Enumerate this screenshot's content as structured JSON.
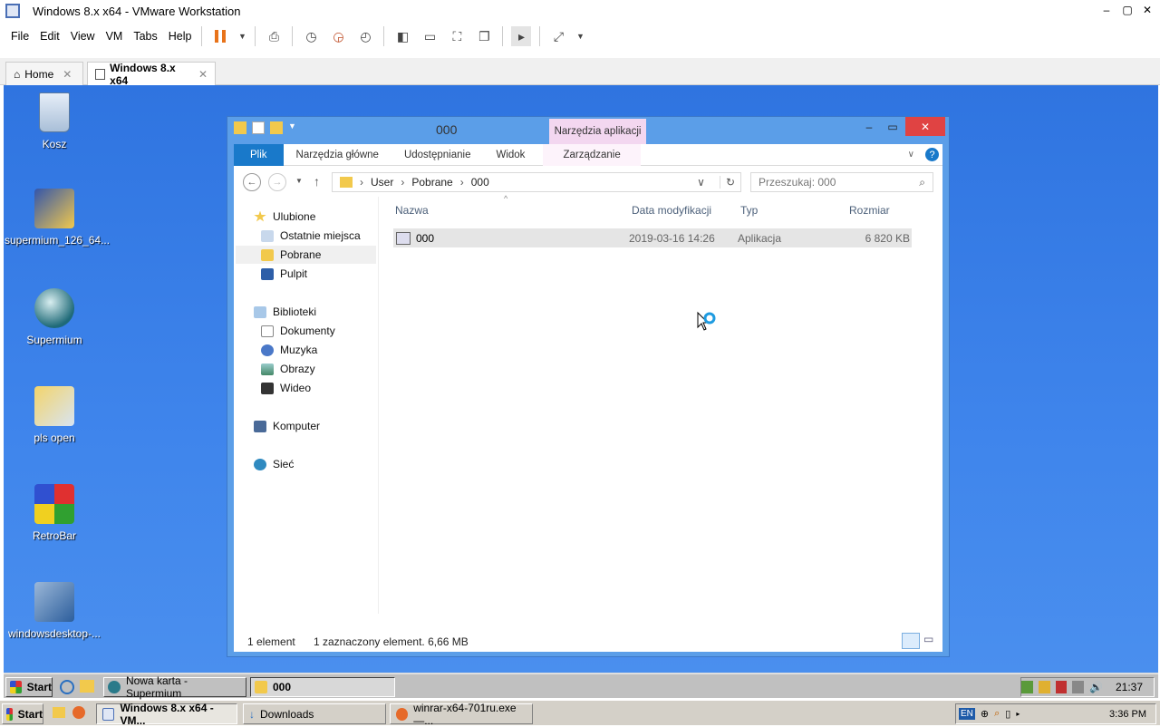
{
  "host": {
    "title": "Windows 8.x x64 - VMware Workstation",
    "window_controls": {
      "minimize": "–",
      "maximize": "▢",
      "close": "✕"
    },
    "menu": [
      "File",
      "Edit",
      "View",
      "VM",
      "Tabs",
      "Help"
    ],
    "tabs": [
      {
        "label": "Home",
        "close": "✕"
      },
      {
        "label": "Windows 8.x x64",
        "close": "✕"
      }
    ]
  },
  "desktop": {
    "icons": [
      {
        "label": "Kosz",
        "icon": "recycle-bin-icon"
      },
      {
        "label": "supermium_126_64...",
        "icon": "installer-icon"
      },
      {
        "label": "Supermium",
        "icon": "browser-icon"
      },
      {
        "label": "pls open",
        "icon": "setup-icon"
      },
      {
        "label": "RetroBar",
        "icon": "retrobar-icon"
      },
      {
        "label": "windowsdesktop-...",
        "icon": "installer-disc-icon"
      }
    ]
  },
  "explorer": {
    "title": "000",
    "context_tab": "Narzędzia aplikacji",
    "ribbon_tabs": [
      "Plik",
      "Narzędzia główne",
      "Udostępnianie",
      "Widok",
      "Zarządzanie"
    ],
    "breadcrumb": [
      "User",
      "Pobrane",
      "000"
    ],
    "search_placeholder": "Przeszukaj: 000",
    "nav": {
      "favorites": "Ulubione",
      "fav_items": [
        "Ostatnie miejsca",
        "Pobrane",
        "Pulpit"
      ],
      "libraries": "Biblioteki",
      "lib_items": [
        "Dokumenty",
        "Muzyka",
        "Obrazy",
        "Wideo"
      ],
      "computer": "Komputer",
      "network": "Sieć"
    },
    "columns": {
      "name": "Nazwa",
      "modified": "Data modyfikacji",
      "type": "Typ",
      "size": "Rozmiar"
    },
    "files": [
      {
        "name": "000",
        "modified": "2019-03-16 14:26",
        "type": "Aplikacja",
        "size": "6 820 KB"
      }
    ],
    "status": {
      "count": "1 element",
      "selected": "1 zaznaczony element. 6,66 MB"
    }
  },
  "guest_taskbar": {
    "start": "Start",
    "buttons": [
      {
        "label": "Nowa karta - Supermium",
        "active": false
      },
      {
        "label": "000",
        "active": true
      }
    ],
    "clock": "21:37"
  },
  "host_taskbar": {
    "start": "Start",
    "buttons": [
      {
        "label": "Windows 8.x x64 - VM...",
        "active": true
      },
      {
        "label": "Downloads",
        "active": false
      },
      {
        "label": "winrar-x64-701ru.exe —...",
        "active": false
      }
    ],
    "lang": "EN",
    "clock": "3:36 PM"
  },
  "colors": {
    "guest_desktop": "#3a7ae0",
    "ribbon_file": "#1979ca",
    "context_tab": "#f3d7f0",
    "close_red": "#e04343"
  }
}
